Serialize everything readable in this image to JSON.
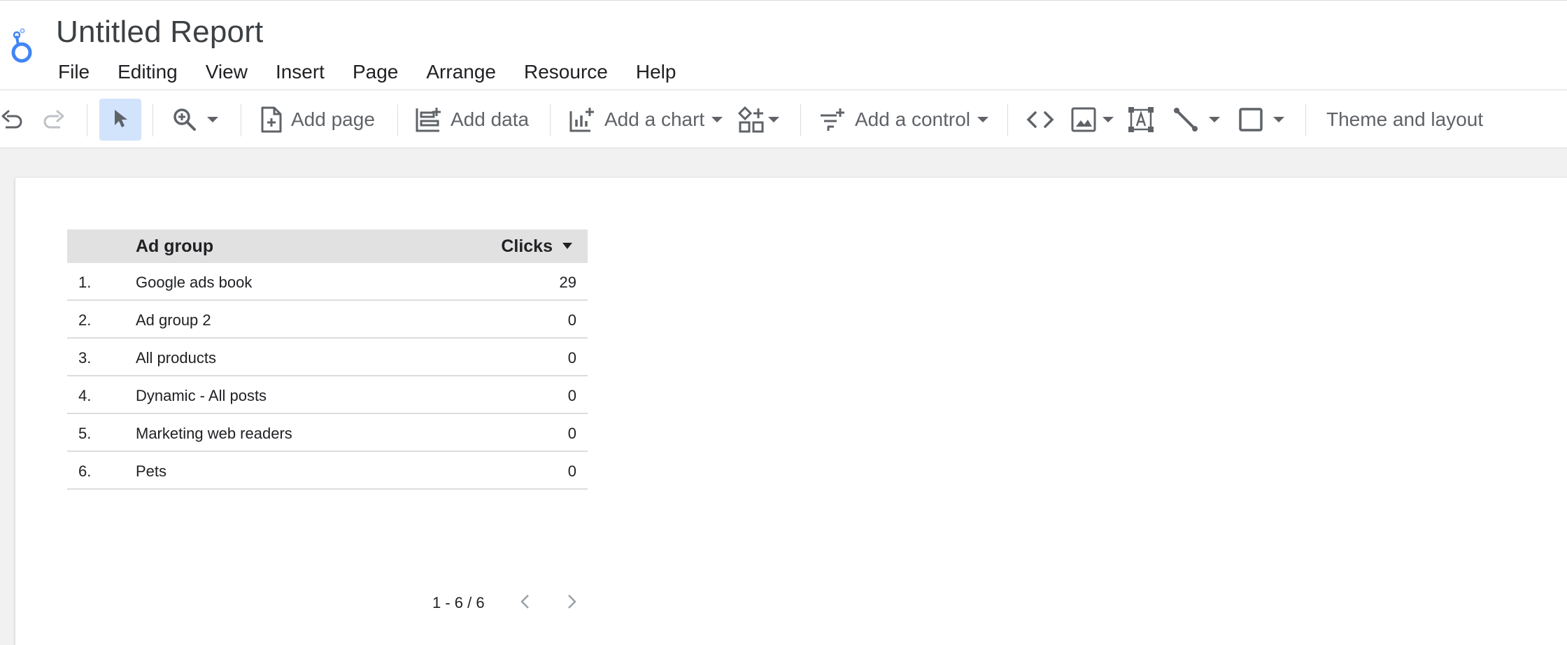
{
  "app": {
    "title": "Untitled Report",
    "brand_color": "#4285f4"
  },
  "menu": [
    "File",
    "Editing",
    "View",
    "Insert",
    "Page",
    "Arrange",
    "Resource",
    "Help"
  ],
  "toolbar": {
    "add_page": "Add page",
    "add_data": "Add data",
    "add_chart": "Add a chart",
    "add_control": "Add a control",
    "theme_layout": "Theme and layout",
    "selected_tool_color": "#d2e3fc"
  },
  "table": {
    "columns": [
      "Ad group",
      "Clicks"
    ],
    "rows": [
      {
        "index": "1.",
        "ad_group": "Google ads book",
        "clicks": "29"
      },
      {
        "index": "2.",
        "ad_group": "Ad group 2",
        "clicks": "0"
      },
      {
        "index": "3.",
        "ad_group": "All products",
        "clicks": "0"
      },
      {
        "index": "4.",
        "ad_group": "Dynamic - All posts",
        "clicks": "0"
      },
      {
        "index": "5.",
        "ad_group": "Marketing web readers",
        "clicks": "0"
      },
      {
        "index": "6.",
        "ad_group": "Pets",
        "clicks": "0"
      }
    ],
    "pagination": "1 - 6 / 6"
  }
}
